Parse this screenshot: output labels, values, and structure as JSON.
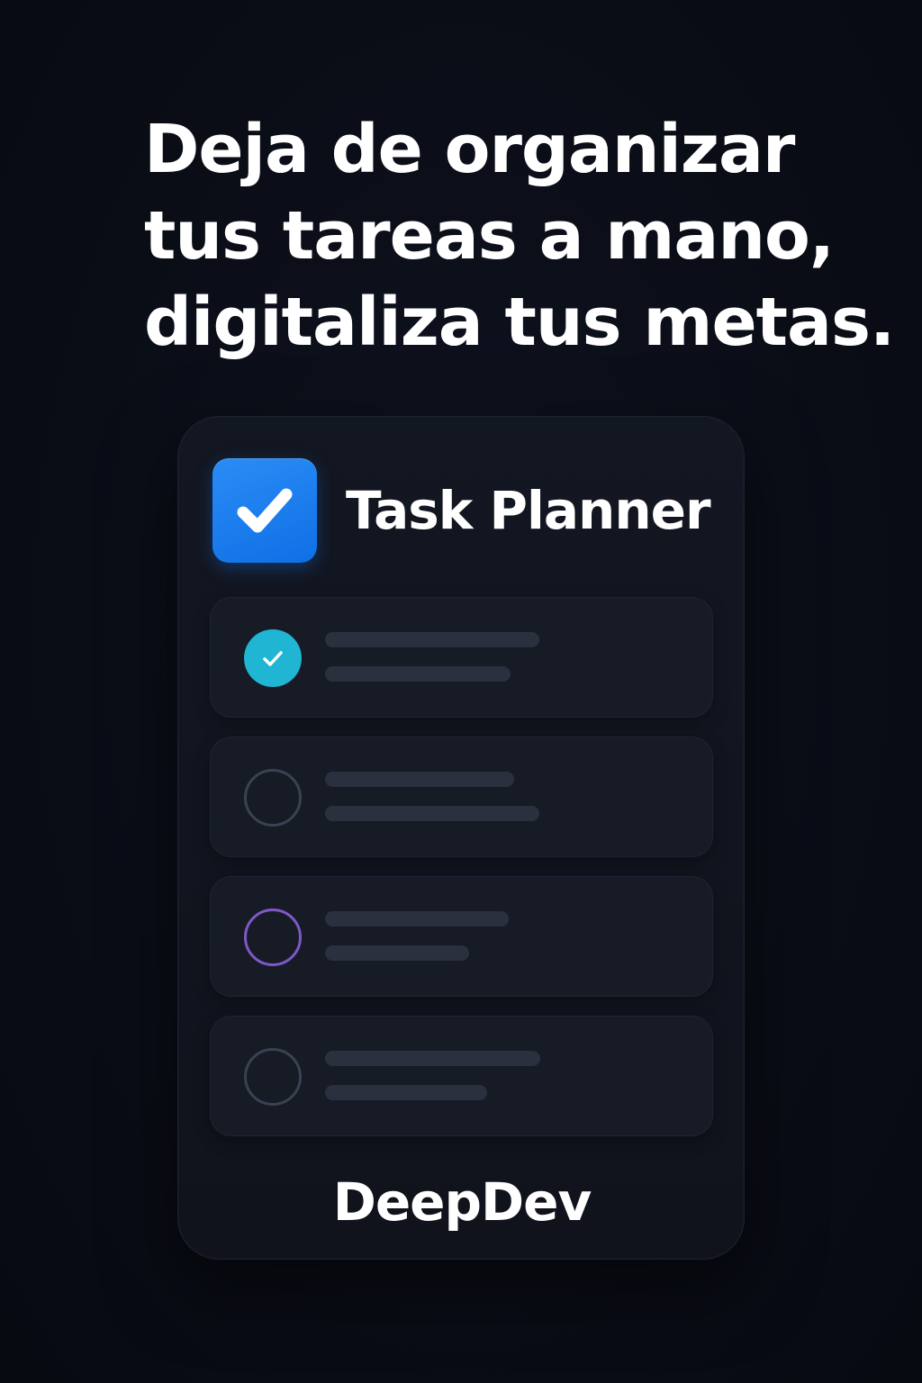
{
  "headline": {
    "lines": [
      "Deja de organizar",
      "tus tareas a mano,",
      "digitaliza tus metas."
    ]
  },
  "app": {
    "title": "Task Planner",
    "icon": "checkbox-check-icon",
    "icon_color": "#1a7ff0"
  },
  "tasks": [
    {
      "state": "completed",
      "icon": "check-circle-icon",
      "color": "#1fb5d3"
    },
    {
      "state": "pending",
      "icon": "empty-circle-icon",
      "color": "#3a4152"
    },
    {
      "state": "pending",
      "icon": "empty-circle-icon",
      "color": "#7e58c6"
    },
    {
      "state": "pending",
      "icon": "empty-circle-icon",
      "color": "#3a4152"
    }
  ],
  "brand": {
    "name": "DeepDev"
  }
}
